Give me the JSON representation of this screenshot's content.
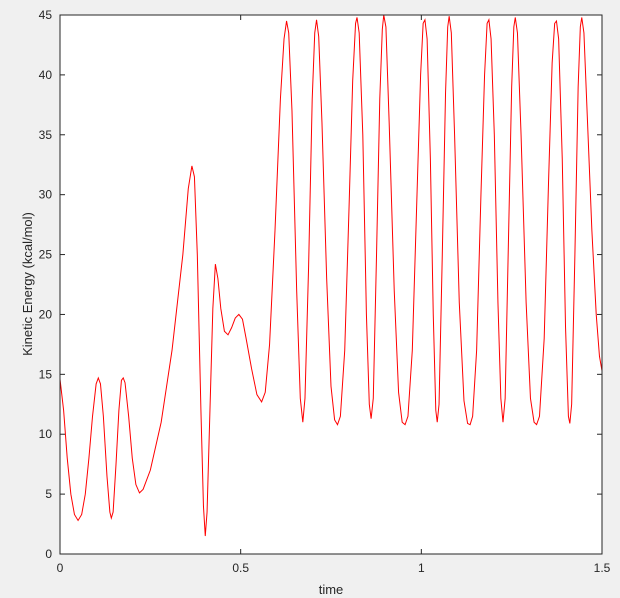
{
  "chart_data": {
    "type": "line",
    "title": "",
    "xlabel": "time",
    "ylabel": "Kinetic Energy (kcal/mol)",
    "xlim": [
      0,
      1.5
    ],
    "ylim": [
      0,
      45
    ],
    "xticks": [
      0,
      0.5,
      1,
      1.5
    ],
    "xtick_labels": [
      "0",
      "0.5",
      "1",
      "1.5"
    ],
    "yticks": [
      0,
      5,
      10,
      15,
      20,
      25,
      30,
      35,
      40,
      45
    ],
    "ytick_labels": [
      "0",
      "5",
      "10",
      "15",
      "20",
      "25",
      "30",
      "35",
      "40",
      "45"
    ],
    "grid": false,
    "series": [
      {
        "color": "#ff0000",
        "points": [
          [
            0.0,
            14.6
          ],
          [
            0.01,
            12.0
          ],
          [
            0.02,
            8.0
          ],
          [
            0.03,
            5.0
          ],
          [
            0.04,
            3.3
          ],
          [
            0.05,
            2.8
          ],
          [
            0.06,
            3.3
          ],
          [
            0.07,
            5.0
          ],
          [
            0.08,
            8.0
          ],
          [
            0.09,
            11.5
          ],
          [
            0.1,
            14.2
          ],
          [
            0.106,
            14.7
          ],
          [
            0.112,
            14.2
          ],
          [
            0.12,
            11.5
          ],
          [
            0.13,
            6.5
          ],
          [
            0.138,
            3.5
          ],
          [
            0.142,
            3.0
          ],
          [
            0.147,
            3.5
          ],
          [
            0.155,
            7.5
          ],
          [
            0.163,
            12.0
          ],
          [
            0.17,
            14.5
          ],
          [
            0.175,
            14.7
          ],
          [
            0.18,
            14.3
          ],
          [
            0.19,
            11.5
          ],
          [
            0.2,
            8.0
          ],
          [
            0.21,
            5.8
          ],
          [
            0.22,
            5.1
          ],
          [
            0.23,
            5.4
          ],
          [
            0.25,
            7.0
          ],
          [
            0.28,
            11.0
          ],
          [
            0.31,
            17.0
          ],
          [
            0.34,
            25.0
          ],
          [
            0.355,
            30.5
          ],
          [
            0.365,
            32.4
          ],
          [
            0.372,
            31.5
          ],
          [
            0.38,
            25.0
          ],
          [
            0.39,
            12.0
          ],
          [
            0.397,
            4.0
          ],
          [
            0.402,
            1.5
          ],
          [
            0.407,
            3.5
          ],
          [
            0.415,
            12.0
          ],
          [
            0.423,
            20.5
          ],
          [
            0.43,
            24.2
          ],
          [
            0.437,
            23.0
          ],
          [
            0.445,
            20.5
          ],
          [
            0.455,
            18.6
          ],
          [
            0.465,
            18.3
          ],
          [
            0.475,
            18.9
          ],
          [
            0.485,
            19.7
          ],
          [
            0.495,
            20.0
          ],
          [
            0.505,
            19.6
          ],
          [
            0.515,
            18.0
          ],
          [
            0.53,
            15.5
          ],
          [
            0.545,
            13.3
          ],
          [
            0.558,
            12.7
          ],
          [
            0.568,
            13.5
          ],
          [
            0.58,
            17.5
          ],
          [
            0.595,
            27.0
          ],
          [
            0.61,
            38.0
          ],
          [
            0.62,
            43.0
          ],
          [
            0.627,
            44.5
          ],
          [
            0.633,
            43.5
          ],
          [
            0.642,
            37.0
          ],
          [
            0.655,
            22.0
          ],
          [
            0.665,
            13.0
          ],
          [
            0.672,
            11.0
          ],
          [
            0.678,
            13.0
          ],
          [
            0.688,
            24.0
          ],
          [
            0.698,
            38.0
          ],
          [
            0.705,
            43.5
          ],
          [
            0.71,
            44.6
          ],
          [
            0.716,
            43.2
          ],
          [
            0.725,
            36.0
          ],
          [
            0.738,
            23.0
          ],
          [
            0.75,
            14.0
          ],
          [
            0.76,
            11.2
          ],
          [
            0.768,
            10.8
          ],
          [
            0.776,
            11.5
          ],
          [
            0.788,
            17.0
          ],
          [
            0.8,
            29.0
          ],
          [
            0.81,
            39.5
          ],
          [
            0.818,
            44.3
          ],
          [
            0.822,
            44.8
          ],
          [
            0.828,
            43.5
          ],
          [
            0.838,
            35.0
          ],
          [
            0.848,
            20.0
          ],
          [
            0.856,
            12.5
          ],
          [
            0.861,
            11.3
          ],
          [
            0.867,
            13.0
          ],
          [
            0.876,
            25.0
          ],
          [
            0.885,
            38.0
          ],
          [
            0.892,
            43.8
          ],
          [
            0.896,
            45.0
          ],
          [
            0.902,
            44.0
          ],
          [
            0.911,
            36.0
          ],
          [
            0.925,
            22.0
          ],
          [
            0.937,
            13.5
          ],
          [
            0.947,
            11.0
          ],
          [
            0.955,
            10.8
          ],
          [
            0.963,
            11.5
          ],
          [
            0.975,
            17.0
          ],
          [
            0.988,
            30.0
          ],
          [
            0.998,
            40.0
          ],
          [
            1.005,
            44.3
          ],
          [
            1.01,
            44.6
          ],
          [
            1.016,
            43.0
          ],
          [
            1.025,
            33.0
          ],
          [
            1.033,
            20.0
          ],
          [
            1.04,
            12.0
          ],
          [
            1.044,
            11.0
          ],
          [
            1.049,
            12.5
          ],
          [
            1.058,
            25.0
          ],
          [
            1.067,
            38.5
          ],
          [
            1.073,
            44.0
          ],
          [
            1.077,
            44.9
          ],
          [
            1.083,
            43.5
          ],
          [
            1.092,
            35.0
          ],
          [
            1.105,
            21.0
          ],
          [
            1.118,
            12.8
          ],
          [
            1.128,
            10.9
          ],
          [
            1.135,
            10.8
          ],
          [
            1.142,
            11.5
          ],
          [
            1.153,
            17.0
          ],
          [
            1.165,
            30.0
          ],
          [
            1.175,
            40.0
          ],
          [
            1.182,
            44.3
          ],
          [
            1.187,
            44.6
          ],
          [
            1.193,
            43.0
          ],
          [
            1.202,
            35.0
          ],
          [
            1.212,
            21.0
          ],
          [
            1.22,
            13.0
          ],
          [
            1.226,
            11.0
          ],
          [
            1.232,
            13.0
          ],
          [
            1.241,
            26.0
          ],
          [
            1.25,
            39.0
          ],
          [
            1.256,
            44.0
          ],
          [
            1.26,
            44.8
          ],
          [
            1.266,
            43.5
          ],
          [
            1.276,
            35.0
          ],
          [
            1.29,
            21.0
          ],
          [
            1.302,
            13.0
          ],
          [
            1.312,
            11.0
          ],
          [
            1.319,
            10.8
          ],
          [
            1.327,
            11.5
          ],
          [
            1.34,
            18.0
          ],
          [
            1.352,
            31.0
          ],
          [
            1.362,
            41.0
          ],
          [
            1.369,
            44.3
          ],
          [
            1.374,
            44.5
          ],
          [
            1.38,
            43.0
          ],
          [
            1.39,
            33.0
          ],
          [
            1.399,
            19.0
          ],
          [
            1.407,
            11.5
          ],
          [
            1.411,
            10.9
          ],
          [
            1.416,
            12.5
          ],
          [
            1.425,
            25.0
          ],
          [
            1.434,
            39.0
          ],
          [
            1.44,
            44.0
          ],
          [
            1.444,
            44.8
          ],
          [
            1.45,
            43.5
          ],
          [
            1.46,
            36.0
          ],
          [
            1.472,
            27.0
          ],
          [
            1.484,
            20.0
          ],
          [
            1.493,
            16.5
          ],
          [
            1.5,
            15.3
          ]
        ]
      }
    ]
  }
}
